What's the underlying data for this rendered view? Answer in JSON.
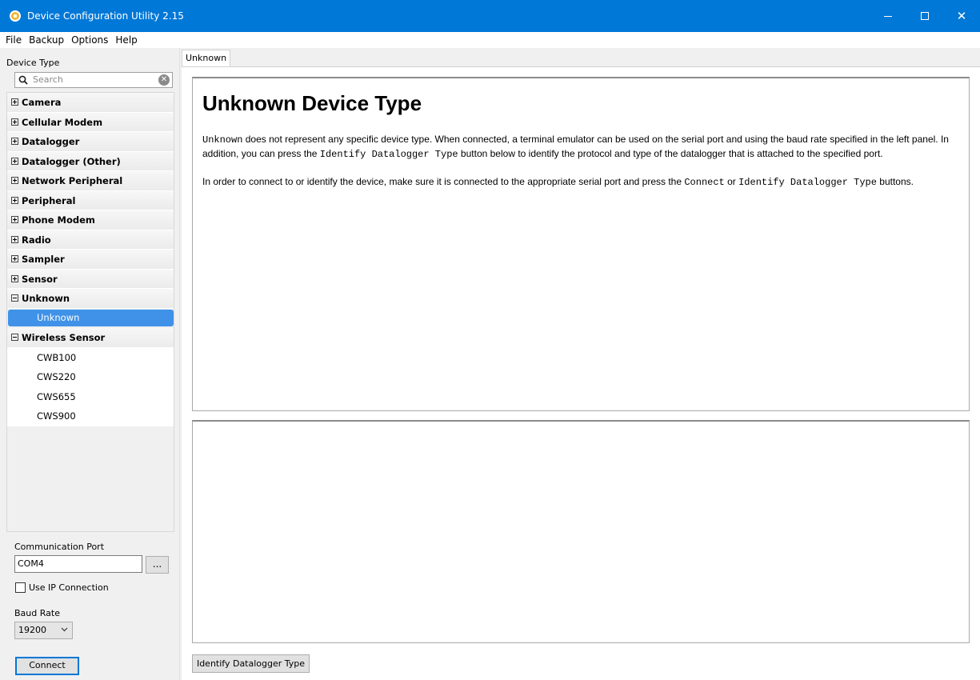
{
  "window": {
    "title": "Device Configuration Utility 2.15",
    "minimize_icon": "minimize-icon",
    "maximize_icon": "maximize-icon",
    "close_icon": "close-icon",
    "close_glyph": "✕"
  },
  "menu": [
    "File",
    "Backup",
    "Options",
    "Help"
  ],
  "left_panel": {
    "device_type_label": "Device Type",
    "search_placeholder": "Search",
    "clear_glyph": "✕",
    "tree": [
      {
        "label": "Camera",
        "expanded": false,
        "children": []
      },
      {
        "label": "Cellular Modem",
        "expanded": false,
        "children": []
      },
      {
        "label": "Datalogger",
        "expanded": false,
        "children": []
      },
      {
        "label": "Datalogger (Other)",
        "expanded": false,
        "children": []
      },
      {
        "label": "Network Peripheral",
        "expanded": false,
        "children": []
      },
      {
        "label": "Peripheral",
        "expanded": false,
        "children": []
      },
      {
        "label": "Phone Modem",
        "expanded": false,
        "children": []
      },
      {
        "label": "Radio",
        "expanded": false,
        "children": []
      },
      {
        "label": "Sampler",
        "expanded": false,
        "children": []
      },
      {
        "label": "Sensor",
        "expanded": false,
        "children": []
      },
      {
        "label": "Unknown",
        "expanded": true,
        "children": [
          "Unknown"
        ]
      },
      {
        "label": "Wireless Sensor",
        "expanded": true,
        "children": [
          "CWB100",
          "CWS220",
          "CWS655",
          "CWS900"
        ]
      }
    ],
    "selected_child": "Unknown",
    "comm_port_label": "Communication Port",
    "comm_port_value": "COM4",
    "browse_label": "...",
    "use_ip_label": "Use IP Connection",
    "use_ip_checked": false,
    "baud_rate_label": "Baud Rate",
    "baud_rate_value": "19200",
    "connect_label": "Connect"
  },
  "main": {
    "tab_label": "Unknown",
    "heading": "Unknown Device Type",
    "p1": {
      "code1": "Unknown",
      "t1": " does not represent any specific device type. When connected, a terminal emulator can be used on the serial port and using the baud rate specified in the left panel. In addition, you can press the ",
      "code2": "Identify Datalogger Type",
      "t2": " button below to identify the protocol and type of the datalogger that is attached to the specified port."
    },
    "p2": {
      "t1": "In order to connect to or identify the device, make sure it is connected to the appropriate serial port and press the ",
      "code1": "Connect",
      "t2": " or ",
      "code2": "Identify Datalogger Type",
      "t3": " buttons."
    },
    "identify_label": "Identify Datalogger Type"
  },
  "colors": {
    "titlebar": "#0078d7",
    "selection": "#3f92e8"
  }
}
